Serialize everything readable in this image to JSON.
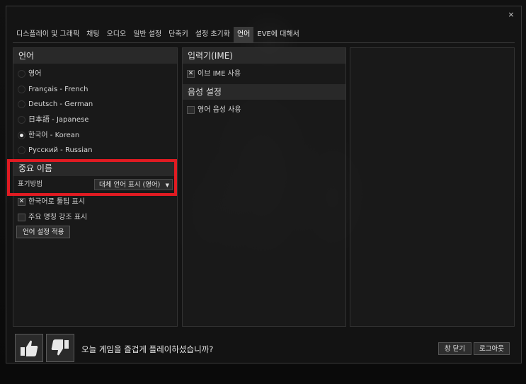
{
  "window": {
    "close_icon": "×"
  },
  "tabs": [
    {
      "label": "디스플레이 및 그래픽",
      "active": false
    },
    {
      "label": "채팅",
      "active": false
    },
    {
      "label": "오디오",
      "active": false
    },
    {
      "label": "일반 설정",
      "active": false
    },
    {
      "label": "단축키",
      "active": false
    },
    {
      "label": "설정 초기화",
      "active": false
    },
    {
      "label": "언어",
      "active": true
    },
    {
      "label": "EVE에 대해서",
      "active": false
    }
  ],
  "language_panel": {
    "title": "언어",
    "options": [
      {
        "label": "영어",
        "selected": false
      },
      {
        "label": "Français - French",
        "selected": false
      },
      {
        "label": "Deutsch - German",
        "selected": false
      },
      {
        "label": "日本語 - Japanese",
        "selected": false
      },
      {
        "label": "한국어 - Korean",
        "selected": true
      },
      {
        "label": "Русский - Russian",
        "selected": false
      }
    ],
    "important_names": {
      "title": "중요 이름",
      "display_label": "표기방법",
      "display_value": "대체 언어 표시 (영어)",
      "tooltip_checkbox": {
        "label": "한국어로 툴팁 표시",
        "checked": true
      },
      "highlight_checkbox": {
        "label": "주요 명칭 강조 표시",
        "checked": false
      },
      "apply_button": "언어 설정 적용"
    }
  },
  "ime_panel": {
    "title": "입력기(IME)",
    "eve_ime": {
      "label": "이브 IME 사용",
      "checked": true
    },
    "voice_title": "음성 설정",
    "english_voice": {
      "label": "영어 음성 사용",
      "checked": false
    }
  },
  "footer": {
    "question": "오늘 게임을 즐겁게 플레이하셨습니까?",
    "close_button": "창 닫기",
    "logout_button": "로그아웃",
    "thumbs_up_icon": "thumbs-up-icon",
    "thumbs_down_icon": "thumbs-down-icon"
  },
  "colors": {
    "highlight": "#e01b22"
  }
}
